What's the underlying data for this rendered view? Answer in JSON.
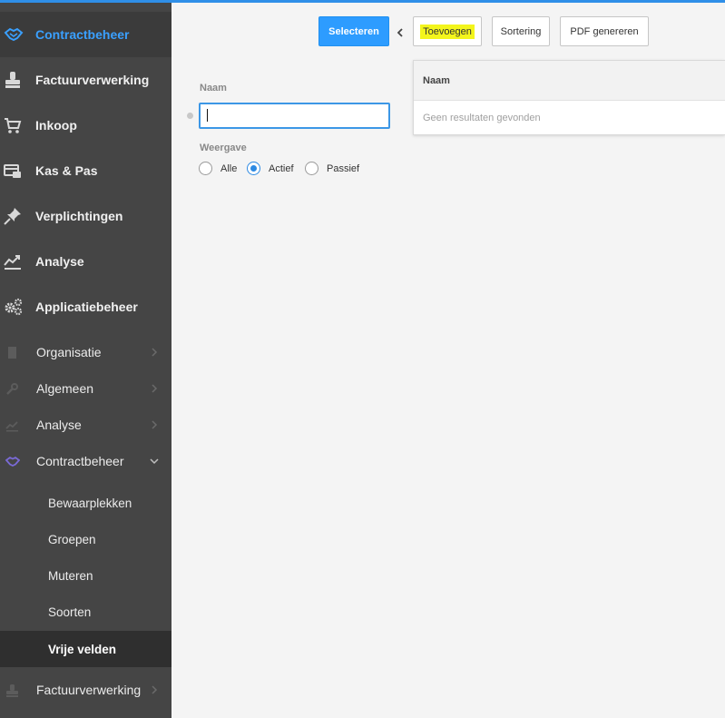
{
  "sidebar": {
    "main": [
      {
        "label": "Contractbeheer",
        "icon": "handshake-icon",
        "active": true
      },
      {
        "label": "Factuurverwerking",
        "icon": "stamp-icon"
      },
      {
        "label": "Inkoop",
        "icon": "cart-icon"
      },
      {
        "label": "Kas & Pas",
        "icon": "register-icon"
      },
      {
        "label": "Verplichtingen",
        "icon": "pin-icon"
      },
      {
        "label": "Analyse",
        "icon": "chart-icon"
      },
      {
        "label": "Applicatiebeheer",
        "icon": "gears-icon"
      }
    ],
    "sub": [
      {
        "label": "Organisatie",
        "icon": "building-icon"
      },
      {
        "label": "Algemeen",
        "icon": "wrench-icon"
      },
      {
        "label": "Analyse",
        "icon": "chart-icon"
      },
      {
        "label": "Contractbeheer",
        "icon": "handshake-icon",
        "expanded": true
      }
    ],
    "subsub": [
      {
        "label": "Bewaarplekken"
      },
      {
        "label": "Groepen"
      },
      {
        "label": "Muteren"
      },
      {
        "label": "Soorten"
      },
      {
        "label": "Vrije velden",
        "selected": true
      }
    ],
    "bottom": {
      "label": "Factuurverwerking",
      "icon": "stamp-icon"
    }
  },
  "toolbar": {
    "select_label": "Selecteren",
    "add_label": "Toevoegen",
    "sort_label": "Sortering",
    "pdf_label": "PDF genereren"
  },
  "form": {
    "name_label": "Naam",
    "name_value": "",
    "display_label": "Weergave",
    "radio_options": [
      {
        "label": "Alle",
        "checked": false
      },
      {
        "label": "Actief",
        "checked": true
      },
      {
        "label": "Passief",
        "checked": false
      }
    ]
  },
  "results": {
    "column_header": "Naam",
    "empty_text": "Geen resultaten gevonden"
  },
  "colors": {
    "accent": "#2d9cff",
    "sidebar_bg": "#454545",
    "highlight": "#f3f51c"
  }
}
